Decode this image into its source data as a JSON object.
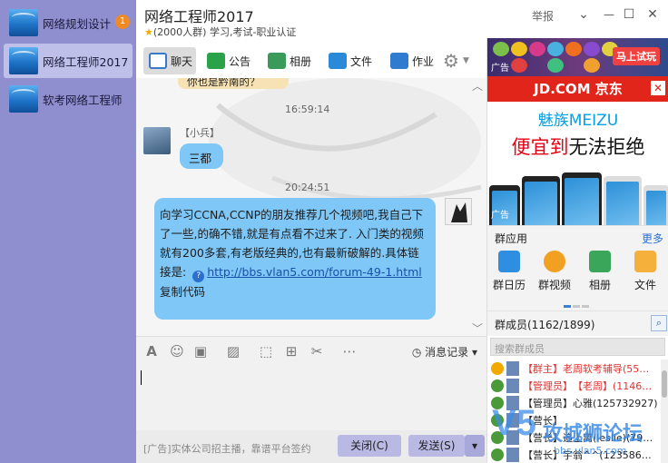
{
  "sidebar": {
    "items": [
      {
        "label": "网络规划设计",
        "badge": "1"
      },
      {
        "label": "网络工程师2017"
      },
      {
        "label": "软考网络工程师"
      }
    ]
  },
  "header": {
    "title": "网络工程师2017",
    "star": "★",
    "subtitle": "(2000人群) 学习,考试-职业认证",
    "report": "举报",
    "chevron": "⌄",
    "minimize": "—",
    "maximize": "☐",
    "close": "✕"
  },
  "tabs": [
    {
      "label": "聊天",
      "icon": "chat-bubble-icon",
      "color": "#3a78c8"
    },
    {
      "label": "公告",
      "icon": "megaphone-icon",
      "color": "#2aa24a"
    },
    {
      "label": "相册",
      "icon": "photo-icon",
      "color": "#3a9a5a"
    },
    {
      "label": "文件",
      "icon": "folder-icon",
      "color": "#2b8ad8"
    },
    {
      "label": "作业",
      "icon": "homework-icon",
      "color": "#2f7bd0"
    }
  ],
  "chat": {
    "partial_bubble": "你也是黔南的？",
    "time1": "16:59:14",
    "sender1": "【小兵】",
    "msg1": "三都",
    "time2": "20:24:51",
    "msg2_lines": [
      "向学习CCNA,CCNP的朋友推荐几个视频吧,我自己下",
      "了一些,的确不错,就是有点看不过来了. 入门类的视频",
      "就有200多套,有老版经典的,也有最新破解的.具体链",
      "接是:"
    ],
    "link": "http://bbs.vlan5.com/forum-49-1.html",
    "copy_code": "复制代码",
    "bubble_color": "#7ec7f7"
  },
  "input": {
    "history": "消息记录",
    "ad_text": "[广告]实体公司招主播，靠谱平台签约",
    "close_btn": "关闭(C)",
    "send_btn": "发送(S)"
  },
  "right": {
    "ad_tag": "广告",
    "ad1_try": "马上试玩",
    "jd": "JD.COM 京东",
    "jd_close": "✕",
    "meizu_brand": "魅族MEIZU",
    "meizu_slogan_a": "便宜到",
    "meizu_slogan_b": "无法拒绝",
    "apps_title": "群应用",
    "apps_more": "更多",
    "apps": [
      {
        "label": "群日历",
        "color": "#2f8ee0",
        "icon": "calendar-icon"
      },
      {
        "label": "群视频",
        "color": "#f2a022",
        "icon": "video-icon"
      },
      {
        "label": "相册",
        "color": "#3aa65a",
        "icon": "album-icon"
      },
      {
        "label": "文件",
        "color": "#f4b03a",
        "icon": "file-folder-icon"
      }
    ],
    "members_title": "群成员(1162/1899)",
    "members_search_placeholder": "搜索群成员",
    "members": [
      {
        "role": "【群主】",
        "name": "老周软考辅导(55…",
        "red": true,
        "icon_color": "#f2a900"
      },
      {
        "role": "【管理员】",
        "name": "【老周】(1146…",
        "red": true,
        "icon_color": "#4a9a3a"
      },
      {
        "role": "【管理员】",
        "name": "心雅(125732927)",
        "red": false,
        "icon_color": "#4a9a3a"
      },
      {
        "role": "【营长】",
        "name": "",
        "red": false,
        "icon_color": "#4a9a3a"
      },
      {
        "role": "【营长】",
        "name": "追上离(leslie)(79…",
        "red": false,
        "icon_color": "#4a9a3a"
      },
      {
        "role": "【营长】",
        "name": "宇翁^^(123586…",
        "red": false,
        "icon_color": "#4a9a3a"
      }
    ]
  },
  "watermark": {
    "big": "V5",
    "title": "攻城狮论坛",
    "sub": "bbs.vlan5.com"
  }
}
